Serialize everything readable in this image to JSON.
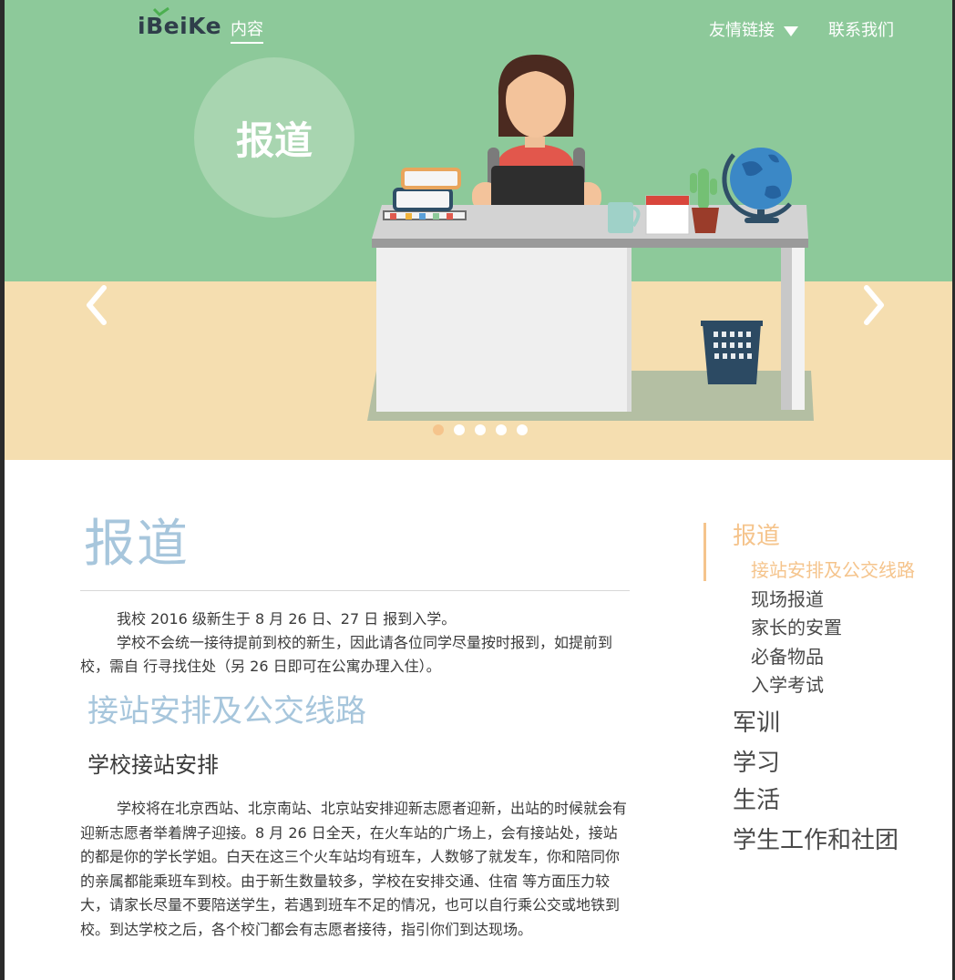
{
  "header": {
    "logo_text": "iBeiKe",
    "nav_content": "内容",
    "nav_links": "友情链接",
    "nav_contact": "联系我们"
  },
  "hero": {
    "badge_text": "报道",
    "carousel": {
      "slide_count": 5,
      "active_index": 0
    },
    "colors": {
      "sky": "#8dc99a",
      "floor": "#f5deb0",
      "dot_active": "#f5c48c"
    }
  },
  "article": {
    "title": "报道",
    "intro": [
      "我校 2016 级新生于 8 月 26 日、27 日 报到入学。",
      "学校不会统一接待提前到校的新生，因此请各位同学尽量按时报到，如提前到校，需自 行寻找住处（另 26 日即可在公寓办理入住）。"
    ],
    "section_title": "接站安排及公交线路",
    "sub_title": "学校接站安排",
    "body": "学校将在北京西站、北京南站、北京站安排迎新志愿者迎新，出站的时候就会有迎新志愿者举着牌子迎接。8 月 26 日全天，在火车站的广场上，会有接站处，接站的都是你的学长学姐。白天在这三个火车站均有班车，人数够了就发车，你和陪同你的亲属都能乘班车到校。由于新生数量较多，学校在安排交通、住宿 等方面压力较大，请家长尽量不要陪送学生，若遇到班车不足的情况，也可以自行乘公交或地铁到校。到达学校之后，各个校门都会有志愿者接待，指引你们到达现场。"
  },
  "sidenav": {
    "group": "报道",
    "sub_items": [
      "接站安排及公交线路",
      "现场报道",
      "家长的安置",
      "必备物品",
      "入学考试"
    ],
    "active_sub": 0,
    "main_items": [
      "军训",
      "学习",
      "生活",
      "学生工作和社团"
    ],
    "colors": {
      "accent": "#f5c48c",
      "text": "#4a4a4a",
      "title": "#a7c6dc"
    }
  }
}
